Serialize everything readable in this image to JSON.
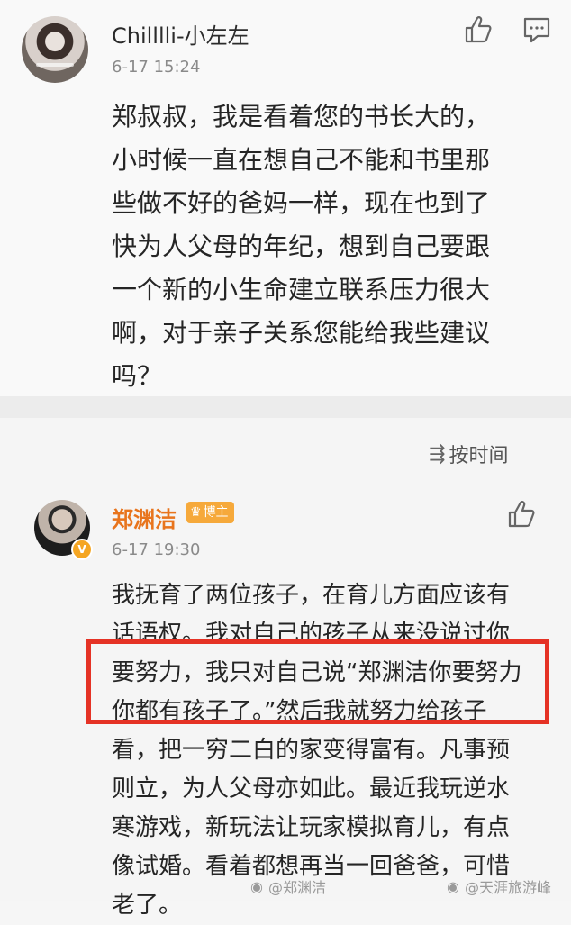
{
  "comment": {
    "username": "Chilllli-小左左",
    "timestamp": "6-17 15:24",
    "lines": [
      "郑叔叔，我是看着您的书长大的，",
      "小时候一直在想自己不能和书里那",
      "些做不好的爸妈一样，现在也到了",
      "快为人父母的年纪，想到自己要跟",
      "一个新的小生命建立联系压力很大",
      "啊，对于亲子关系您能给我些建议",
      "吗？"
    ]
  },
  "sort": {
    "label": "按时间",
    "icon": "sort-icon"
  },
  "reply": {
    "username": "郑渊洁",
    "badge_label": "博主",
    "verified_label": "V",
    "timestamp": "6-17 19:30",
    "lines": [
      "我抚育了两位孩子，在育儿方面应该有",
      "话语权。我对自己的孩子从来没说过你",
      "要努力，我只对自己说“郑渊洁你要努力",
      "你都有孩子了。”然后我就努力给孩子",
      "看，把一穷二白的家变得富有。凡事预",
      "则立，为人父母亦如此。最近我玩逆水",
      "寒游戏，新玩法让玩家模拟育儿，有点",
      "像试婚。看着都想再当一回爸爸，可惜",
      "老了。"
    ]
  },
  "watermarks": [
    "@郑渊洁",
    "@天涯旅游峰"
  ],
  "colors": {
    "highlight": "#e53225",
    "reply_name": "#e8741c",
    "badge": "#f6a93b"
  }
}
